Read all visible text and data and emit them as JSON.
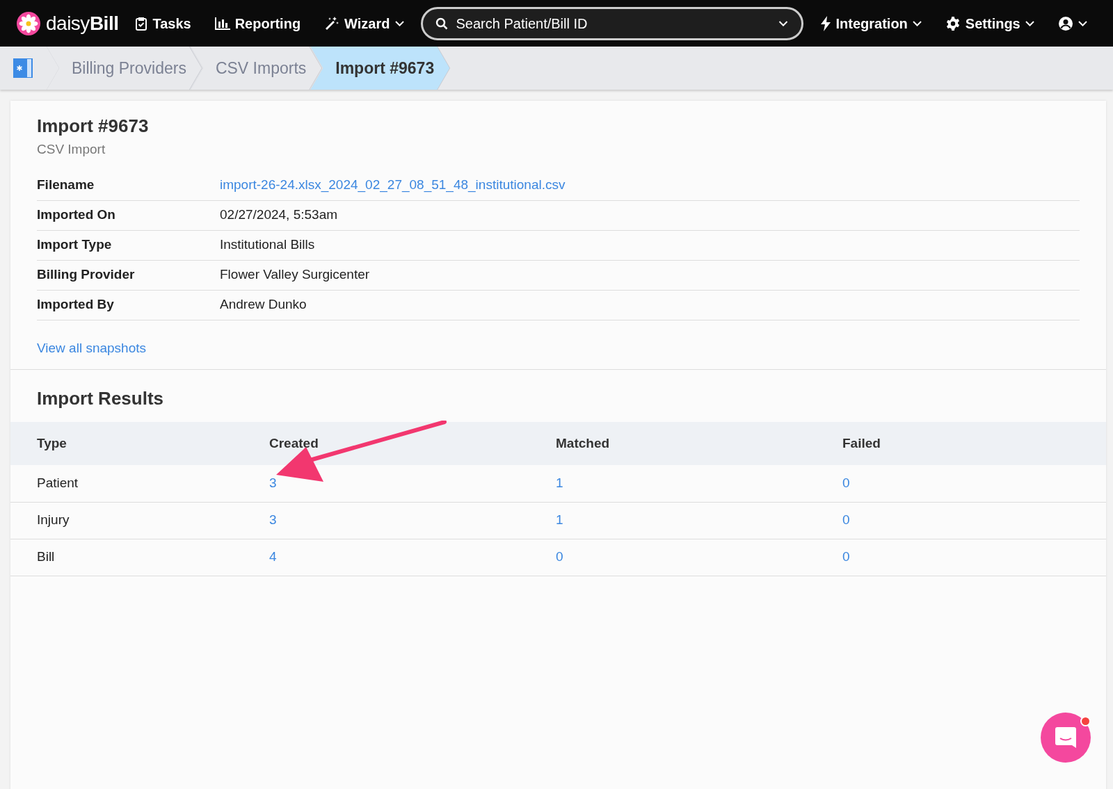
{
  "navbar": {
    "logo": "daisy**Bill**",
    "items": [
      {
        "kind": "tasks",
        "label": "Tasks",
        "dropdown": false
      },
      {
        "kind": "reporting",
        "label": "Reporting",
        "dropdown": false
      },
      {
        "kind": "wizard",
        "label": "Wizard",
        "dropdown": true
      }
    ],
    "search": {
      "placeholder": "Search Patient/Bill ID"
    },
    "right_items": [
      {
        "kind": "integration",
        "label": "Integration",
        "dropdown": true
      },
      {
        "kind": "settings",
        "label": "Settings",
        "dropdown": true
      },
      {
        "kind": "account",
        "dropdown": true
      }
    ]
  },
  "breadcrumbs": [
    {
      "label": "Billing Providers",
      "selected": false
    },
    {
      "label": "CSV Imports",
      "selected": false
    },
    {
      "label": "Import #9673",
      "selected": true
    }
  ],
  "import": {
    "title": "Import #9673",
    "subtitle": "CSV Import",
    "details": [
      {
        "label": "Filename",
        "value": "import-26-24.xlsx_2024_02_27_08_51_48_institutional.csv",
        "link": true
      },
      {
        "label": "Imported On",
        "value": "02/27/2024, 5:53am",
        "link": false
      },
      {
        "label": "Import Type",
        "value": "Institutional Bills",
        "link": false
      },
      {
        "label": "Billing Provider",
        "value": "Flower Valley Surgicenter",
        "link": false
      },
      {
        "label": "Imported By",
        "value": "Andrew Dunko",
        "link": false
      }
    ],
    "snapshots_link": "View all snapshots"
  },
  "results": {
    "title": "Import Results",
    "columns": [
      "Type",
      "Created",
      "Matched",
      "Failed"
    ],
    "rows": [
      {
        "type": "Patient",
        "counts": [
          "3",
          "1",
          "0"
        ]
      },
      {
        "type": "Injury",
        "counts": [
          "3",
          "1",
          "0"
        ]
      },
      {
        "type": "Bill",
        "counts": [
          "4",
          "0",
          "0"
        ]
      }
    ]
  },
  "chat": {
    "notification": true
  }
}
